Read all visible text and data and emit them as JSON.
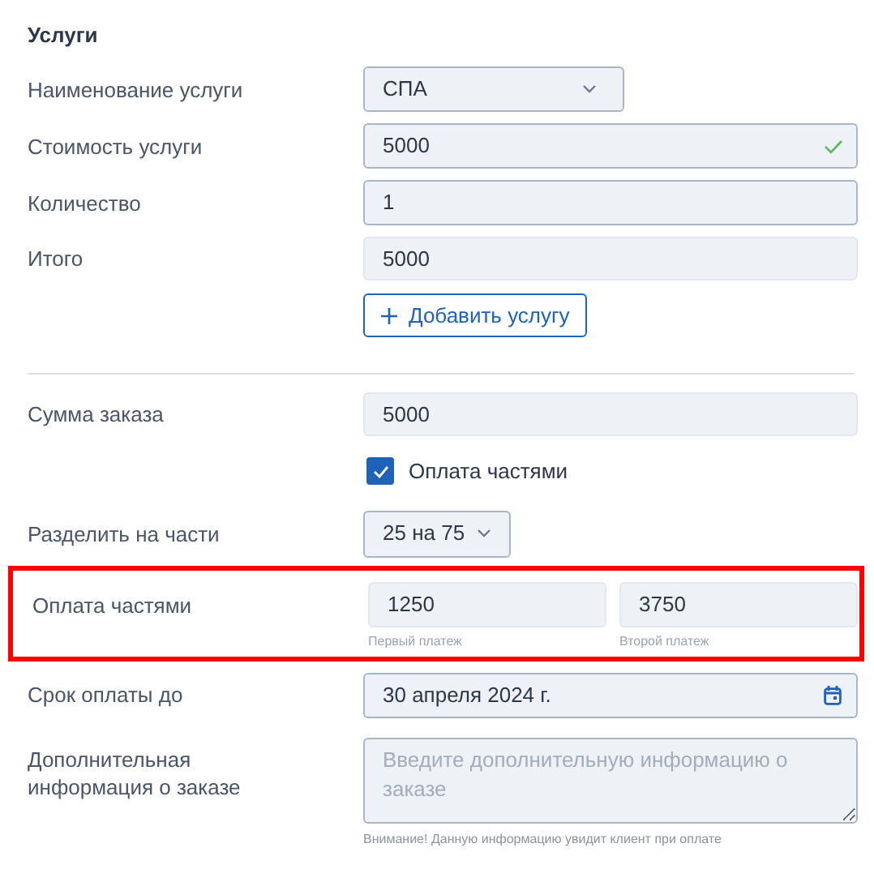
{
  "section_title": "Услуги",
  "service_fields": [
    {
      "label": "Наименование услуги",
      "kind": "select",
      "value": "СПА",
      "valid": false
    },
    {
      "label": "Стоимость услуги",
      "kind": "input",
      "value": "5000",
      "valid": true
    },
    {
      "label": "Количество",
      "kind": "input",
      "value": "1",
      "valid": false
    },
    {
      "label": "Итого",
      "kind": "readonly",
      "value": "5000",
      "valid": false
    }
  ],
  "add_button": {
    "label": "Добавить услугу"
  },
  "order_total": {
    "label": "Сумма заказа",
    "value": "5000"
  },
  "installments_checkbox": {
    "label": "Оплата частями",
    "checked": true
  },
  "split": {
    "label": "Разделить на части",
    "value": "25 на 75"
  },
  "installments": {
    "label": "Оплата частями",
    "highlighted": true,
    "payments": [
      {
        "value": "1250",
        "caption": "Первый платеж"
      },
      {
        "value": "3750",
        "caption": "Второй платеж"
      }
    ]
  },
  "due_date": {
    "label": "Срок оплаты до",
    "value": "30 апреля 2024 г."
  },
  "notes": {
    "label": "Дополнительная информация о заказе",
    "placeholder": "Введите дополнительную информацию о заказе",
    "hint": "Внимание! Данную информацию увидит клиент при оплате"
  }
}
